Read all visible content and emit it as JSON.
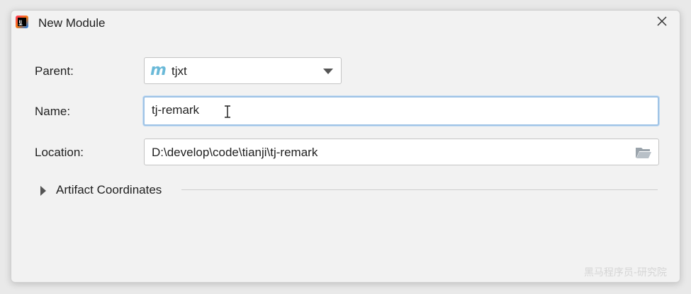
{
  "window": {
    "title": "New Module",
    "app_icon": "intellij-idea-icon",
    "close_icon": "close-icon"
  },
  "form": {
    "parent": {
      "label": "Parent:",
      "value": "tjxt",
      "icon": "maven-icon",
      "icon_glyph": "m"
    },
    "name": {
      "label": "Name:",
      "value": "tj-remark"
    },
    "location": {
      "label": "Location:",
      "value": "D:\\develop\\code\\tianji\\tj-remark",
      "icon": "folder-icon"
    },
    "artifact": {
      "label": "Artifact Coordinates",
      "expanded": false
    }
  },
  "watermark": "黑马程序员-研究院",
  "colors": {
    "focus_border": "#9fc3e6",
    "maven_icon": "#6ab9d8",
    "dialog_bg": "#f2f2f2"
  }
}
